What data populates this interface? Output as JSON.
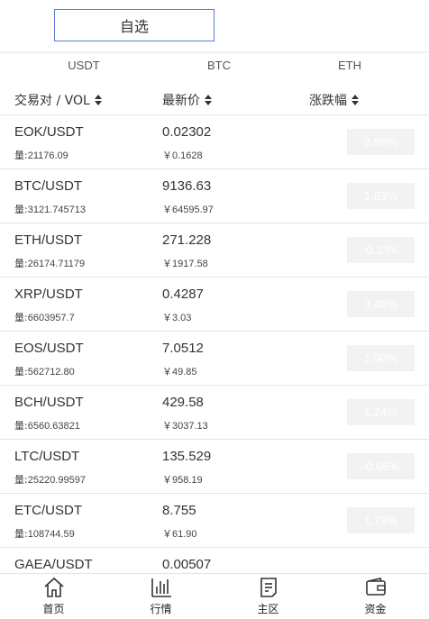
{
  "header": {
    "favorites_label": "自选"
  },
  "market_tabs": [
    "USDT",
    "BTC",
    "ETH"
  ],
  "columns": {
    "pair_vol": "交易对 / VOL",
    "latest_price": "最新价",
    "change": "涨跌幅"
  },
  "vol_prefix": "量:",
  "currency_symbol": "￥",
  "rows": [
    {
      "pair": "EOK/USDT",
      "vol": "21176.09",
      "price": "0.02302",
      "cny": "0.1628",
      "change": "9.99%"
    },
    {
      "pair": "BTC/USDT",
      "vol": "3121.745713",
      "price": "9136.63",
      "cny": "64595.97",
      "change": "1.83%"
    },
    {
      "pair": "ETH/USDT",
      "vol": "26174.71179",
      "price": "271.228",
      "cny": "1917.58",
      "change": "-0.33%"
    },
    {
      "pair": "XRP/USDT",
      "vol": "6603957.7",
      "price": "0.4287",
      "cny": "3.03",
      "change": "3.48%"
    },
    {
      "pair": "EOS/USDT",
      "vol": "562712.80",
      "price": "7.0512",
      "cny": "49.85",
      "change": "1.90%"
    },
    {
      "pair": "BCH/USDT",
      "vol": "6560.63821",
      "price": "429.58",
      "cny": "3037.13",
      "change": "1.24%"
    },
    {
      "pair": "LTC/USDT",
      "vol": "25220.99597",
      "price": "135.529",
      "cny": "958.19",
      "change": "-0.66%"
    },
    {
      "pair": "ETC/USDT",
      "vol": "108744.59",
      "price": "8.755",
      "cny": "61.90",
      "change": "1.79%"
    },
    {
      "pair": "GAEA/USDT",
      "vol": "",
      "price": "0.00507",
      "cny": "",
      "change": ""
    }
  ],
  "bottom_nav": [
    {
      "label": "首页",
      "icon": "home-icon"
    },
    {
      "label": "行情",
      "icon": "chart-bars-icon"
    },
    {
      "label": "主区",
      "icon": "document-icon"
    },
    {
      "label": "资金",
      "icon": "wallet-icon"
    }
  ],
  "colors": {
    "accent_border": "#5b7bd5",
    "change_badge_bg": "#f2f2f2"
  }
}
